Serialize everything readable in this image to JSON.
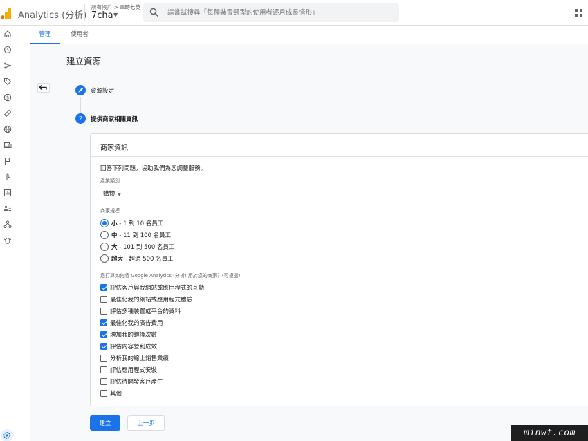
{
  "app": {
    "title": "Analytics (分析)"
  },
  "account": {
    "path": "所有帳戶 > 串時七英",
    "name": "7cha"
  },
  "search": {
    "placeholder": "請嘗試搜尋「每種裝置類型的使用者逐月成長情形」"
  },
  "tabs": [
    {
      "label": "管理",
      "active": true
    },
    {
      "label": "使用者",
      "active": false
    }
  ],
  "page": {
    "title": "建立資源"
  },
  "steps": [
    {
      "label": "資源設定",
      "badge": "",
      "state": "done"
    },
    {
      "label": "提供商家相關資訊",
      "badge": "2",
      "state": "active"
    }
  ],
  "card": {
    "title": "商家資訊",
    "intro": "回答下列問題，協助我們為您調整服務。",
    "industry_label": "產業類別",
    "industry_value": "購物",
    "size_label": "商家規模",
    "sizes": [
      {
        "bold": "小",
        "text": " - 1 到 10 名員工",
        "selected": true
      },
      {
        "bold": "中",
        "text": " - 11 到 100 名員工",
        "selected": false
      },
      {
        "bold": "大",
        "text": " - 101 到 500 名員工",
        "selected": false
      },
      {
        "bold": "超大",
        "text": " - 超過 500 名員工",
        "selected": false
      }
    ],
    "usage_label": "您打算如何將 Google Analytics (分析) 用於您的商家？(可複選)",
    "usages": [
      {
        "label": "評估客戶與我網站或應用程式的互動",
        "checked": true
      },
      {
        "label": "最佳化我的網站或應用程式體驗",
        "checked": false
      },
      {
        "label": "評估多種裝置或平台的資料",
        "checked": false
      },
      {
        "label": "最佳化我的廣告費用",
        "checked": true
      },
      {
        "label": "增加我的轉換次數",
        "checked": true
      },
      {
        "label": "評估內容營利成效",
        "checked": true
      },
      {
        "label": "分析我的線上銷售業績",
        "checked": false
      },
      {
        "label": "評估應用程式安裝",
        "checked": false
      },
      {
        "label": "評估待開發客戶產生",
        "checked": false
      },
      {
        "label": "其他",
        "checked": false
      }
    ]
  },
  "buttons": {
    "create": "建立",
    "previous": "上一步"
  },
  "watermark": "minwt.com",
  "colors": {
    "accent": "#1a73e8",
    "logo": "#f9ab00"
  },
  "rail_icons": [
    "home-icon",
    "clock-icon",
    "explore-icon",
    "tag-icon",
    "dollar-icon",
    "ruler-icon",
    "globe-icon",
    "devices-icon",
    "flag-icon",
    "touch-icon",
    "report-icon",
    "audience-icon",
    "network-icon",
    "bug-icon"
  ]
}
